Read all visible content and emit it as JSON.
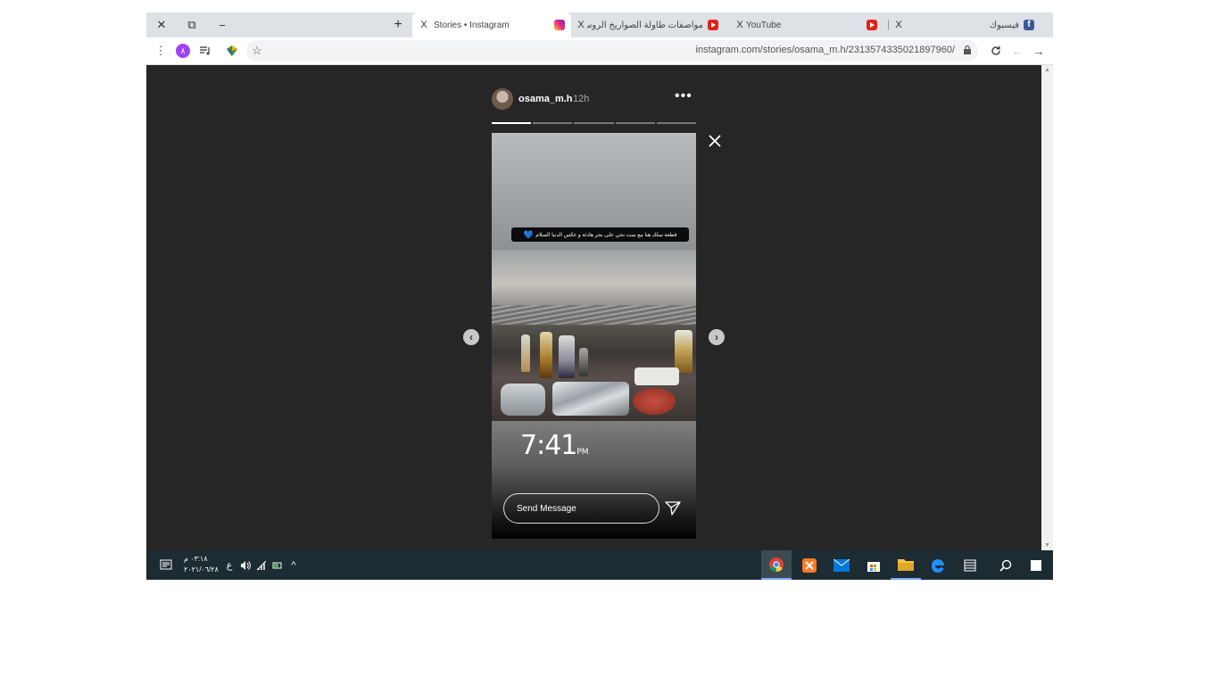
{
  "browser": {
    "window_controls": {
      "close": "✕",
      "restore": "⧉",
      "minimize": "−"
    },
    "new_tab": "+",
    "tabs": [
      {
        "title": "Stories • Instagram",
        "close": "X",
        "favicon": "instagram-icon"
      },
      {
        "title": "مواصفات طاولة الصواريخ الروس",
        "close": "X",
        "favicon": "youtube-icon"
      },
      {
        "title": "YouTube",
        "close": "X",
        "favicon": "youtube-icon"
      },
      {
        "title": "فيسبوك",
        "close": "X",
        "favicon": "facebook-icon"
      }
    ],
    "profile_initial": "٨",
    "url": "instagram.com/stories/osama_m.h/2313574335021897960/",
    "accent_color": "#a142f4"
  },
  "story": {
    "username": "osama_m.h",
    "time_ago": "12h",
    "more": "•••",
    "segments": 5,
    "active_segment": 1,
    "caption": "قطعة سلك هنا مع ست نحي على بحر هادئة و عكس الدنيا السلام",
    "clock_time": "7:41",
    "clock_suffix": "PM",
    "message_placeholder": "Send Message",
    "prev": "‹",
    "next": "›"
  },
  "taskbar": {
    "time": "٠٣:١٨ م",
    "date": "٢٠٢١/٠٦/٢٨",
    "lang": "ع",
    "colors": {
      "bg": "#1d2b33",
      "active": "#3c4a52"
    }
  }
}
